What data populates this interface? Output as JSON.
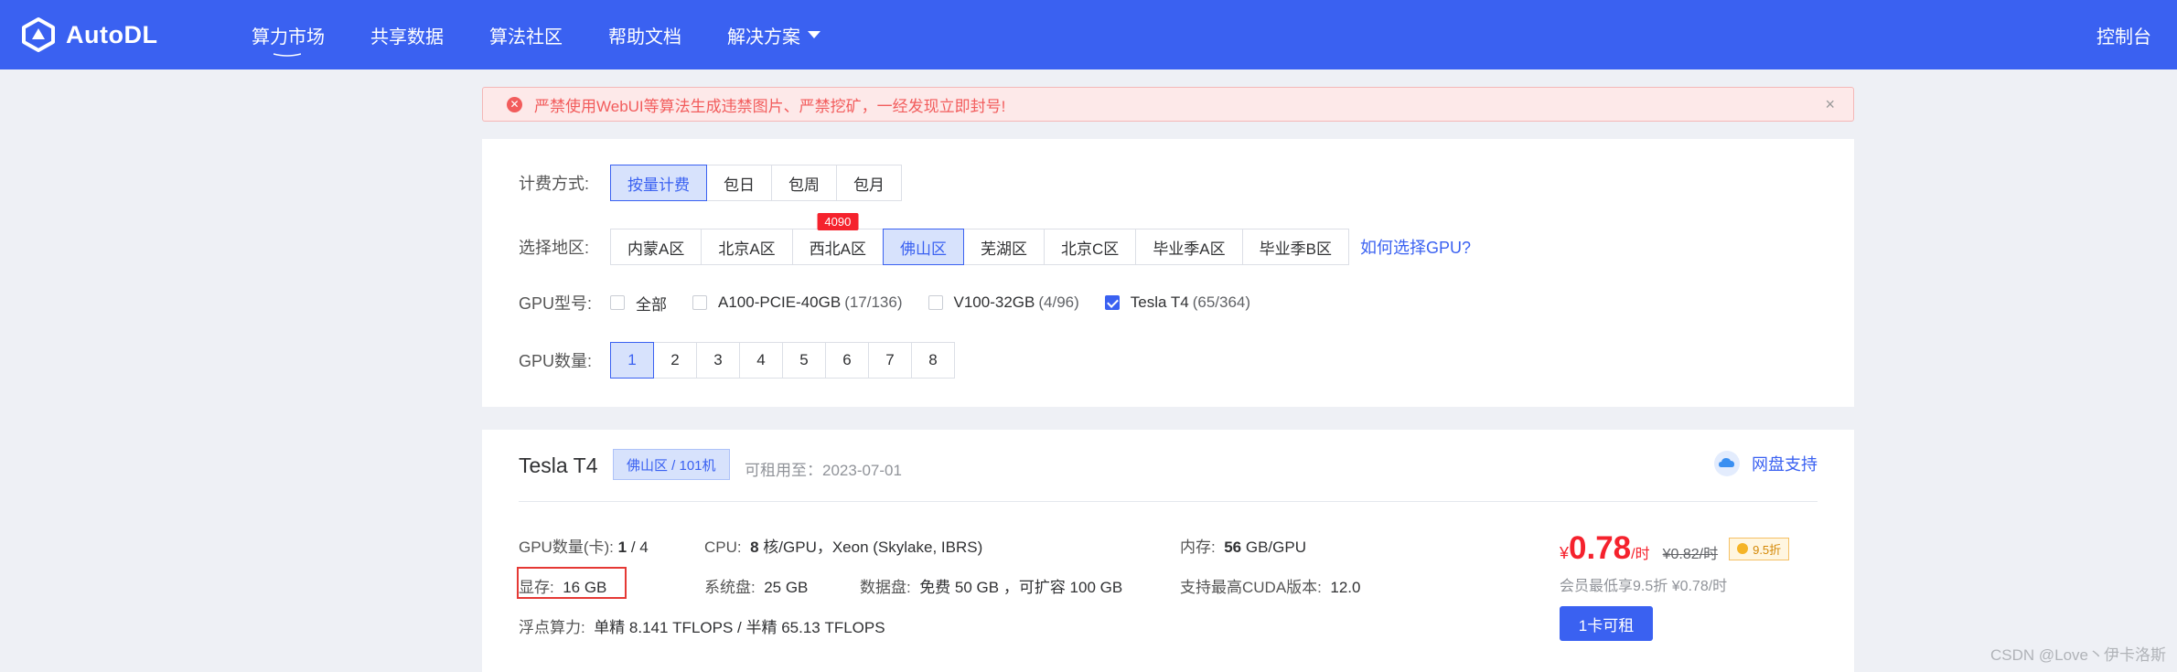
{
  "nav": {
    "logo_text": "AutoDL",
    "items": [
      {
        "label": "算力市场",
        "active": true
      },
      {
        "label": "共享数据"
      },
      {
        "label": "算法社区"
      },
      {
        "label": "帮助文档"
      },
      {
        "label": "解决方案",
        "dropdown": true
      }
    ],
    "console_label": "控制台"
  },
  "alert": {
    "text": "严禁使用WebUI等算法生成违禁图片、严禁挖矿，一经发现立即封号!",
    "close": "×"
  },
  "filters": {
    "billing": {
      "label": "计费方式:",
      "options": [
        "按量计费",
        "包日",
        "包周",
        "包月"
      ],
      "selected": "按量计费"
    },
    "region": {
      "label": "选择地区:",
      "options": [
        "内蒙A区",
        "北京A区",
        "西北A区",
        "佛山区",
        "芜湖区",
        "北京C区",
        "毕业季A区",
        "毕业季B区"
      ],
      "selected": "佛山区",
      "badge": {
        "option": "西北A区",
        "text": "4090"
      },
      "help_link": "如何选择GPU?"
    },
    "gpu_type": {
      "label": "GPU型号:",
      "options": [
        {
          "name": "全部",
          "count": "",
          "checked": false
        },
        {
          "name": "A100-PCIE-40GB",
          "count": "(17/136)",
          "checked": false
        },
        {
          "name": "V100-32GB",
          "count": "(4/96)",
          "checked": false
        },
        {
          "name": "Tesla T4",
          "count": "(65/364)",
          "checked": true
        }
      ]
    },
    "gpu_count": {
      "label": "GPU数量:",
      "options": [
        "1",
        "2",
        "3",
        "4",
        "5",
        "6",
        "7",
        "8"
      ],
      "selected": "1"
    }
  },
  "card": {
    "title": "Tesla T4",
    "region_tag": "佛山区 / 101机",
    "rent_until": "可租用至：2023-07-01",
    "cloud_label": "网盘支持",
    "specs": {
      "gpu_count_label": "GPU数量(卡):",
      "gpu_count_value": "1",
      "gpu_count_total": "/ 4",
      "vram_label": "显存:",
      "vram_value": "16 GB",
      "flops_label": "浮点算力:",
      "flops_value": "单精 8.141 TFLOPS / 半精 65.13 TFLOPS",
      "cpu_label": "CPU:",
      "cpu_value_bold": "8",
      "cpu_value_rest": "核/GPU，Xeon (Skylake, IBRS)",
      "sys_disk_label": "系统盘:",
      "sys_disk_value": "25 GB",
      "data_disk_label": "数据盘:",
      "data_disk_value": "免费 50 GB ，可扩容 100 GB",
      "mem_label": "内存:",
      "mem_value_bold": "56",
      "mem_value_rest": "GB/GPU",
      "cuda_label": "支持最高CUDA版本:",
      "cuda_value": "12.0"
    },
    "price": {
      "yen": "¥",
      "value": "0.78",
      "unit": "/时",
      "old": "¥0.82/时",
      "discount": "9.5折",
      "member": "会员最低享9.5折 ¥0.78/时"
    },
    "rent_button": "1卡可租"
  },
  "watermark": "CSDN @Love丶伊卡洛斯",
  "colors": {
    "brand": "#3a61f1",
    "alert": "#f25c5c",
    "price": "#f5222d",
    "highlight_box": "#e53935"
  }
}
